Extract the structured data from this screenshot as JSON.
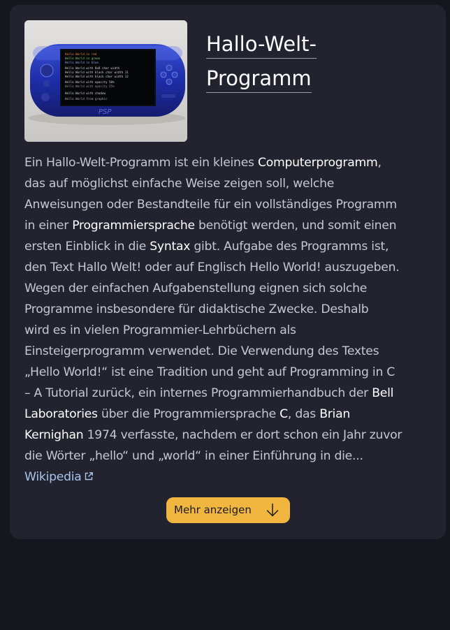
{
  "article": {
    "title_line1": "Hallo-Welt-",
    "title_line2": "Programm",
    "description": {
      "l1a": "Ein Hallo-Welt-Programm ist ein kleines ",
      "l1b": "Computerprogramm",
      "l1c": ",",
      "l2": "das auf möglichst einfache Weise zeigen soll, welche",
      "l3": "Anweisungen oder Bestandteile für ein vollständiges Programm",
      "l4a": "in einer ",
      "l4b": "Programmiersprache",
      "l4c": " benötigt werden, und somit einen",
      "l5a": "ersten Einblick in die ",
      "l5b": "Syntax",
      "l5c": " gibt. Aufgabe des Programms ist,",
      "l6": "den Text Hallo Welt! oder auf Englisch Hello World! auszugeben.",
      "l7": "Wegen der einfachen Aufgabenstellung eignen sich solche",
      "l8": "Programme insbesondere für didaktische Zwecke. Deshalb",
      "l9": "wird es in vielen Programmier-Lehrbüchern als",
      "l10": "Einsteigerprogramm verwendet. Die Verwendung des Textes",
      "l11": "„Hello World!“ ist eine Tradition und geht auf Programming in C",
      "l12a": "– A Tutorial zurück, ein internes Programmierhandbuch der ",
      "l12b": "Bell",
      "l13a": "Laboratories",
      "l13b": " über die Programmiersprache ",
      "l13c": "C",
      "l13d": ", das ",
      "l13e": "Brian",
      "l14a": "Kernighan",
      "l14b": " 1974 verfasste, nachdem er dort schon ein Jahr zuvor",
      "l15": "die Wörter „hello“ und „world“ in einer Einführung in die..."
    },
    "source_link": "Wikipedia",
    "source_icon": "external-link-icon",
    "more_button_label": "Mehr anzeigen",
    "more_button_icon": "arrow-down-icon"
  },
  "image": {
    "alt_icon": "psp-console-image",
    "brand_text": "PSP",
    "screen_lines": [
      "Hallo World in red",
      "Hello World in green",
      "Hello World in blue",
      "Hello World with 8x8 char width",
      "Hello World with black char width 11",
      "Hello World with black char width 12",
      "Hello World with opacity 50%",
      "Hello World with opacity 25%",
      "Hello World with shadow",
      "Hello World from graphic"
    ]
  },
  "colors": {
    "background": "#16171e",
    "card": "#22232e",
    "accent_button": "#f1b63f",
    "link": "#a9c3ee",
    "text_muted": "#c6c7cf",
    "text_strong": "#ffffff"
  }
}
